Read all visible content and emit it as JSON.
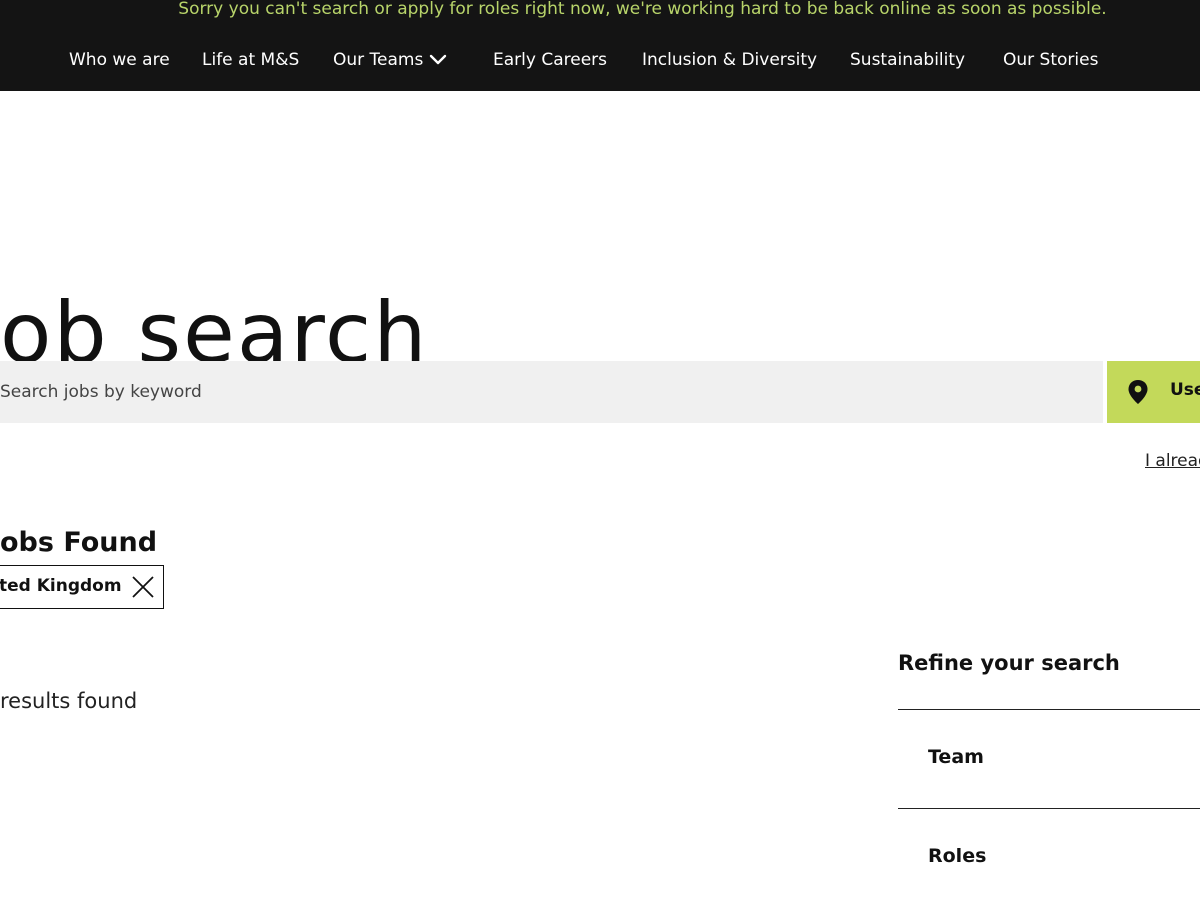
{
  "banner": {
    "message": "Sorry you can't search or apply for roles right now, we're working hard to be back online as soon as possible."
  },
  "nav": {
    "items": [
      {
        "label": "Who we are"
      },
      {
        "label": "Life at M&S"
      },
      {
        "label": "Our Teams",
        "has_dropdown": true
      },
      {
        "label": "Early Careers"
      },
      {
        "label": "Inclusion & Diversity"
      },
      {
        "label": "Sustainability"
      },
      {
        "label": "Our Stories"
      }
    ]
  },
  "page": {
    "title": "ob search"
  },
  "search": {
    "placeholder": "Search jobs by keyword",
    "value": "",
    "location_button_label": "Use",
    "location_icon": "map-pin-icon"
  },
  "links": {
    "already": "I alread"
  },
  "results": {
    "heading": "obs Found",
    "active_filter": "ted Kingdom",
    "count_text": "results found"
  },
  "refine": {
    "heading": "Refine your search",
    "facets": [
      {
        "label": "Team"
      },
      {
        "label": "Roles"
      }
    ]
  },
  "colors": {
    "topbar_bg": "#141414",
    "banner_text": "#b8d46a",
    "accent_lime": "#c3d95a",
    "search_bg": "#f0f0f0"
  }
}
